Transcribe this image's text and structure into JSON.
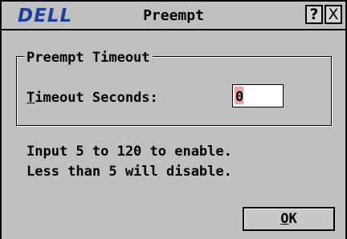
{
  "window": {
    "logo": "DELL",
    "title": "Preempt",
    "help_glyph": "?",
    "close_glyph": "X"
  },
  "group": {
    "legend": "Preempt Timeout",
    "field_label_first": "T",
    "field_label_rest": "imeout Seconds:",
    "field_value": "0"
  },
  "info": {
    "line1": "Input 5 to 120 to enable.",
    "line2": "Less than 5 will disable."
  },
  "ok_button": {
    "first": "O",
    "rest": "K"
  },
  "colors": {
    "background": "#c0c0c0",
    "logo": "#1a3fa0",
    "cursor": "#f0a0a0"
  },
  "icons": [
    "help-icon",
    "close-icon"
  ]
}
